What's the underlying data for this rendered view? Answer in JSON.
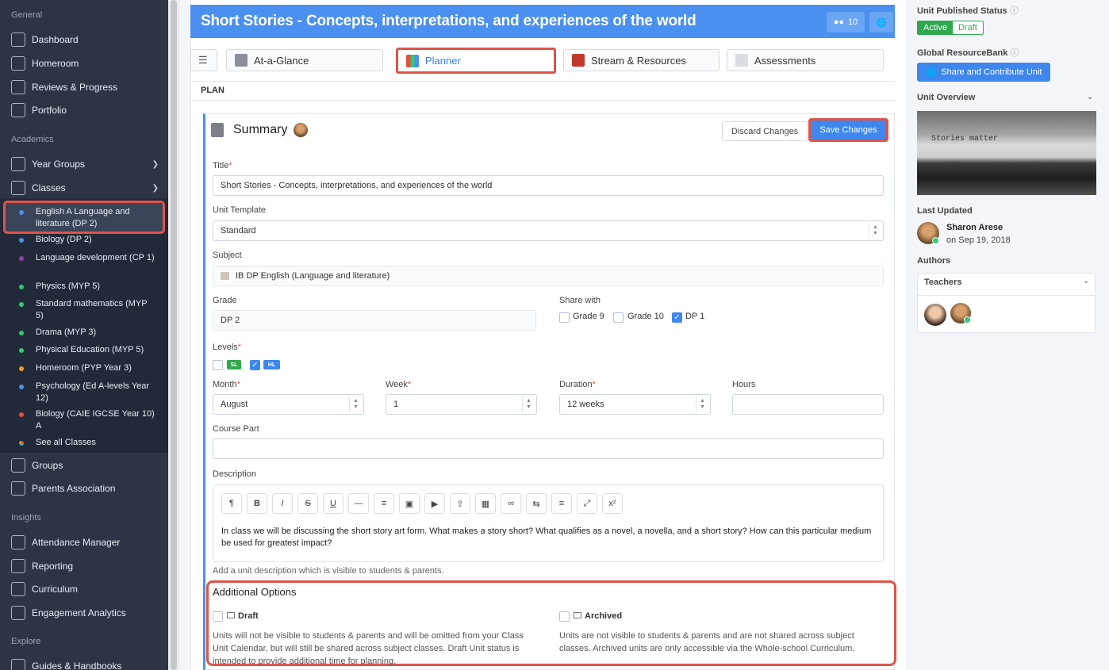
{
  "sidebar": {
    "sections": {
      "general": "General",
      "academics": "Academics",
      "insights": "Insights",
      "explore": "Explore"
    },
    "general_items": [
      "Dashboard",
      "Homeroom",
      "Reviews & Progress",
      "Portfolio"
    ],
    "academic_items": {
      "year_groups": "Year Groups",
      "classes": "Classes",
      "groups": "Groups",
      "parents": "Parents Association"
    },
    "classes": [
      {
        "label": "English A Language and literature (DP 2)",
        "color": "#4a90f0"
      },
      {
        "label": "Biology (DP 2)",
        "color": "#4a90f0"
      },
      {
        "label": "Language development (CP 1)",
        "color": "#8e44ad"
      },
      {
        "label": "Physics (MYP 5)",
        "color": "#2ecc71"
      },
      {
        "label": "Standard mathematics (MYP 5)",
        "color": "#2ecc71"
      },
      {
        "label": "Drama (MYP 3)",
        "color": "#2ecc71"
      },
      {
        "label": "Physical Education (MYP 5)",
        "color": "#2ecc71"
      },
      {
        "label": "Homeroom (PYP Year 3)",
        "color": "#f39c12"
      },
      {
        "label": "Psychology (Ed A-levels Year 12)",
        "color": "#4a90f0"
      },
      {
        "label": "Biology (CAIE IGCSE Year 10) A",
        "color": "#e74c3c"
      }
    ],
    "see_all": "See all Classes",
    "insight_items": [
      "Attendance Manager",
      "Reporting",
      "Curriculum",
      "Engagement Analytics"
    ],
    "explore_items": [
      "Guides & Handbooks"
    ]
  },
  "header": {
    "title": "Short Stories - Concepts, interpretations, and experiences of the world",
    "members": "10"
  },
  "tabs": [
    "At-a-Glance",
    "Planner",
    "Stream & Resources",
    "Assessments"
  ],
  "plan_label": "PLAN",
  "summary": {
    "title": "Summary",
    "discard": "Discard Changes",
    "save": "Save Changes",
    "fields": {
      "title_label": "Title",
      "title_value": "Short Stories - Concepts, interpretations, and experiences of the world",
      "template_label": "Unit Template",
      "template_value": "Standard",
      "subject_label": "Subject",
      "subject_value": "IB DP English (Language and literature)",
      "grade_label": "Grade",
      "grade_value": "DP 2",
      "share_label": "Share with",
      "share_options": [
        "Grade 9",
        "Grade 10",
        "DP 1"
      ],
      "levels_label": "Levels",
      "levels": [
        "SL",
        "HL"
      ],
      "month_label": "Month",
      "month_value": "August",
      "week_label": "Week",
      "week_value": "1",
      "duration_label": "Duration",
      "duration_value": "12 weeks",
      "hours_label": "Hours",
      "course_part_label": "Course Part",
      "description_label": "Description",
      "description_text": "In class we will be discussing the short story art form. What makes a story short? What qualifies as a novel, a novella, and a short story? How can this particular medium be used for greatest impact?",
      "description_hint": "Add a unit description which is visible to students & parents."
    },
    "additional": {
      "title": "Additional Options",
      "draft_label": "Draft",
      "draft_desc": "Units will not be visible to students & parents and will be omitted from your Class Unit Calendar, but will still be shared across subject classes. Draft Unit status is intended to provide additional time for planning.",
      "archived_label": "Archived",
      "archived_desc": "Units are not visible to students & parents and are not shared across subject classes. Archived units are only accessible via the Whole-school Curriculum."
    }
  },
  "right_panel": {
    "published_label": "Unit Published Status",
    "status_active": "Active",
    "status_draft": "Draft",
    "resourcebank_label": "Global ResourceBank",
    "share_button": "Share and Contribute Unit",
    "overview_label": "Unit Overview",
    "overview_image_text": "Stories matter",
    "last_updated_label": "Last Updated",
    "updated_by": "Sharon Arese",
    "updated_on": "on Sep 19, 2018",
    "authors_label": "Authors",
    "teachers_label": "Teachers"
  },
  "colors": {
    "accent": "#4a90f0",
    "highlight": "#e0534a",
    "sidebar": "#2d3545",
    "success": "#2fa84f"
  }
}
